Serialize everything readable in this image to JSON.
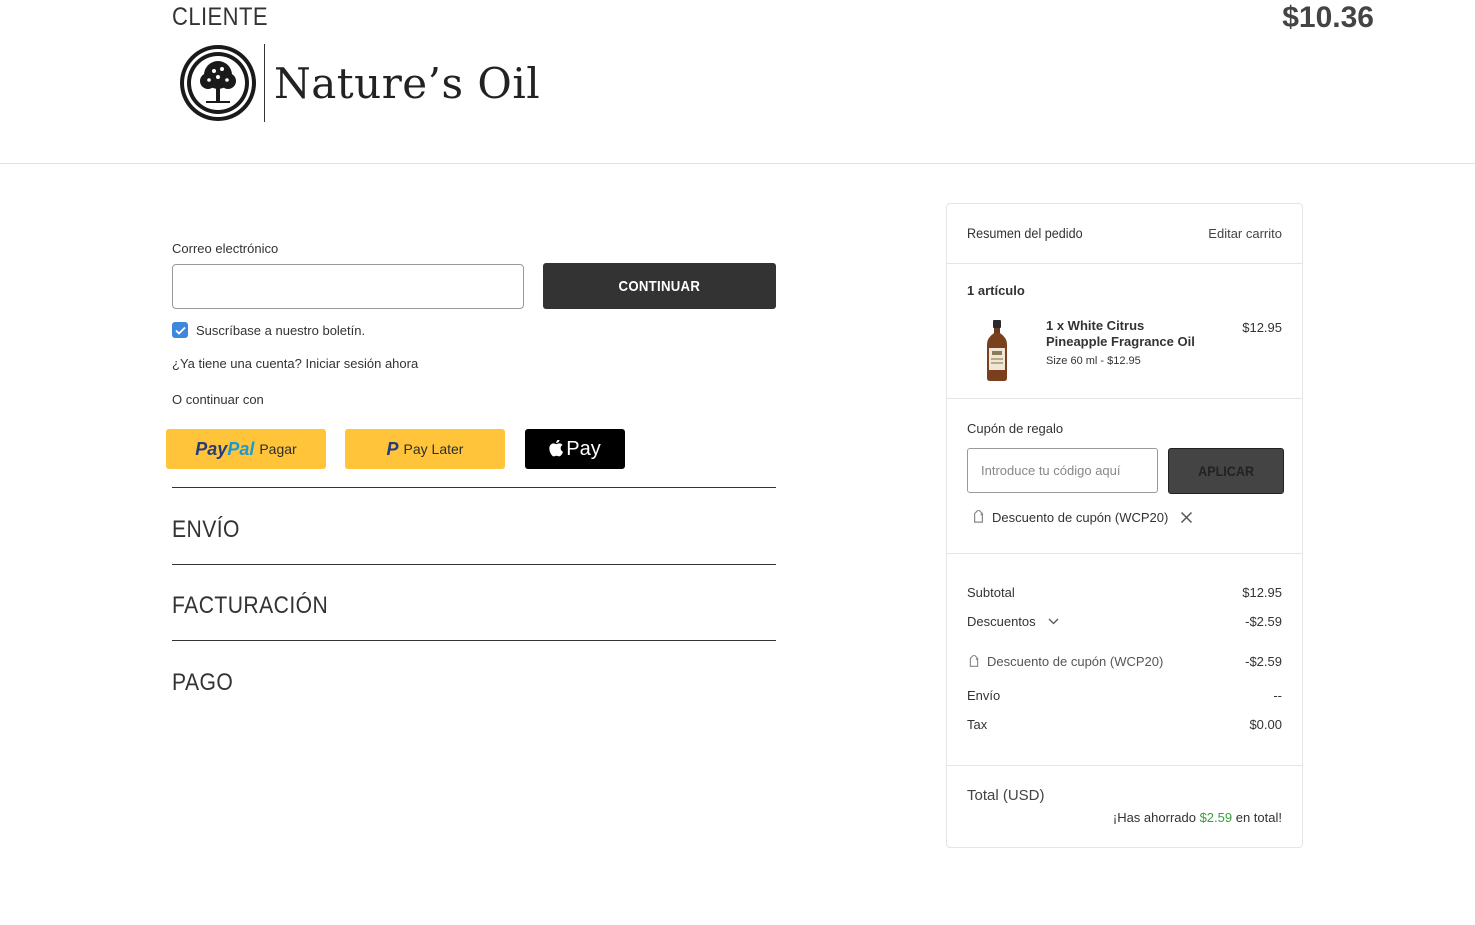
{
  "header": {
    "step_title": "CLIENTE",
    "total": "$10.36",
    "logo_text": "Nature’s Oil"
  },
  "customer": {
    "email_label": "Correo electrónico",
    "email_value": "",
    "continue_label": "CONTINUAR",
    "newsletter_label": "Suscríbase a nuestro boletín.",
    "newsletter_checked": true,
    "login_prompt": "¿Ya tiene una cuenta? Iniciar sesión ahora",
    "or_continue": "O continuar con"
  },
  "payment_buttons": {
    "paypal_brand_1": "Pay",
    "paypal_brand_2": "Pal",
    "paypal_label": "Pagar",
    "paylater_label": "Pay Later",
    "applepay_label": "Pay"
  },
  "sections": {
    "shipping": "ENVÍO",
    "billing": "FACTURACIÓN",
    "payment": "PAGO"
  },
  "summary": {
    "title": "Resumen del pedido",
    "edit_cart": "Editar carrito",
    "items_count": "1 artículo",
    "product": {
      "name": "1 x White Citrus Pineapple Fragrance Oil",
      "variant": "Size 60 ml - $12.95",
      "price": "$12.95"
    },
    "coupon": {
      "label": "Cupón de regalo",
      "placeholder": "Introduce tu código aquí",
      "apply_label": "APLICAR",
      "applied": "Descuento de cupón (WCP20)"
    },
    "totals": {
      "subtotal_label": "Subtotal",
      "subtotal_value": "$12.95",
      "discounts_label": "Descuentos",
      "discounts_value": "-$2.59",
      "coupon_discount_label": "Descuento de cupón (WCP20)",
      "coupon_discount_value": "-$2.59",
      "shipping_label": "Envío",
      "shipping_value": "--",
      "tax_label": "Tax",
      "tax_value": "$0.00",
      "total_label": "Total (USD)",
      "saved_prefix": "¡Has ahorrado ",
      "saved_amount": "$2.59",
      "saved_suffix": " en total!"
    }
  },
  "colors": {
    "primary_button": "#333333",
    "checkbox": "#3d87dc",
    "paypal_yellow": "#ffc439",
    "savings_green": "#3b9c3b"
  }
}
